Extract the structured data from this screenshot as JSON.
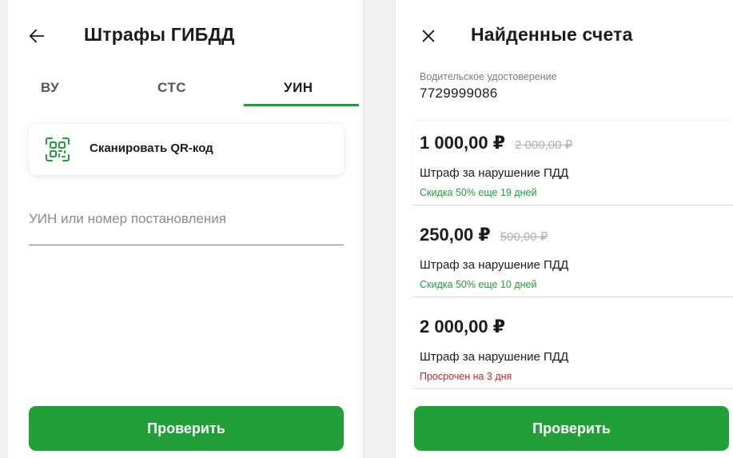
{
  "left_screen": {
    "title": "Штрафы ГИБДД",
    "back_icon": "arrow-left-icon",
    "tabs": [
      {
        "label": "ВУ",
        "active": false
      },
      {
        "label": "СТС",
        "active": false
      },
      {
        "label": "УИН",
        "active": true
      }
    ],
    "scan_qr": {
      "label": "Сканировать QR-код",
      "icon": "qr-code-icon"
    },
    "uin_input": {
      "value": "",
      "placeholder": "УИН или номер постановления"
    },
    "check_button": "Проверить"
  },
  "right_screen": {
    "title": "Найденные счета",
    "close_icon": "close-icon",
    "document": {
      "caption": "Водительское удостоверение",
      "number": "7729999086"
    },
    "fines": [
      {
        "amount": "1 000,00 ₽",
        "old_amount": "2 000,00 ₽",
        "title": "Штраф за нарушение ПДД",
        "status": "Скидка 50% еще 19 дней",
        "status_type": "discount"
      },
      {
        "amount": "250,00 ₽",
        "old_amount": "500,00 ₽",
        "title": "Штраф за нарушение ПДД",
        "status": "Скидка 50% еще 10 дней",
        "status_type": "discount"
      },
      {
        "amount": "2 000,00 ₽",
        "old_amount": "",
        "title": "Штраф за нарушение ПДД",
        "status": "Просрочен на 3 дня",
        "status_type": "overdue"
      }
    ],
    "check_button": "Проверить"
  },
  "colors": {
    "accent": "#21a038",
    "overdue": "#c62828",
    "muted": "#7d7d7d"
  }
}
